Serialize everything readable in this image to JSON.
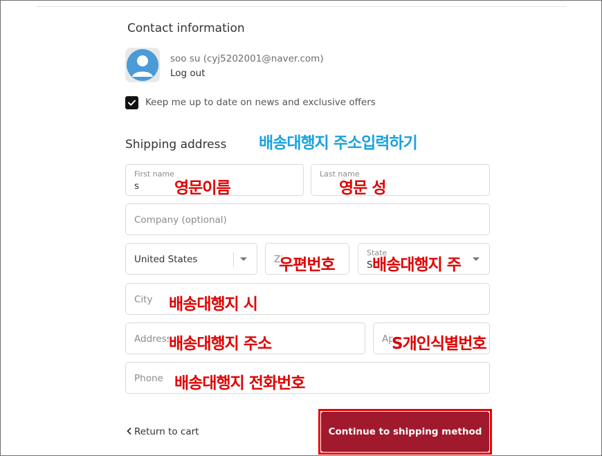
{
  "contact": {
    "title": "Contact information",
    "user": "soo su (cyj5202001@naver.com)",
    "logout": "Log out",
    "newsletter_label": "Keep me up to date on news and exclusive offers",
    "newsletter_checked": true
  },
  "shipping": {
    "title": "Shipping address",
    "fields": {
      "first_name": {
        "label": "First name",
        "value": "s"
      },
      "last_name": {
        "label": "Last name",
        "value": ""
      },
      "company": {
        "placeholder": "Company (optional)"
      },
      "country": {
        "value": "United States"
      },
      "zip": {
        "placeholder": "Zi"
      },
      "state": {
        "label": "State",
        "value": "St"
      },
      "city": {
        "placeholder": "City"
      },
      "address": {
        "placeholder": "Address"
      },
      "apartment": {
        "placeholder": "Apa"
      },
      "phone": {
        "placeholder": "Phone"
      }
    }
  },
  "annotations": {
    "header": "배송대행지 주소입력하기",
    "first_name": "영문이름",
    "last_name": "영문 성",
    "zip": "우편번호",
    "state": "배송대행지 주",
    "city": "배송대행지 시",
    "address": "배송대행지 주소",
    "apartment": "S개인식별번호",
    "phone": "배송대행지 전화번호"
  },
  "footer": {
    "return_label": "Return to cart",
    "continue_label": "Continue to shipping method"
  },
  "icons": {
    "back": "chevron-left-icon",
    "avatar": "user-avatar-icon",
    "check": "checkmark-icon",
    "dropdown": "caret-down-icon"
  },
  "colors": {
    "cta_bg": "#a0192c",
    "annotation_red": "#e00000",
    "annotation_blue": "#1aa2e0",
    "avatar_blue": "#4a9bd6"
  }
}
